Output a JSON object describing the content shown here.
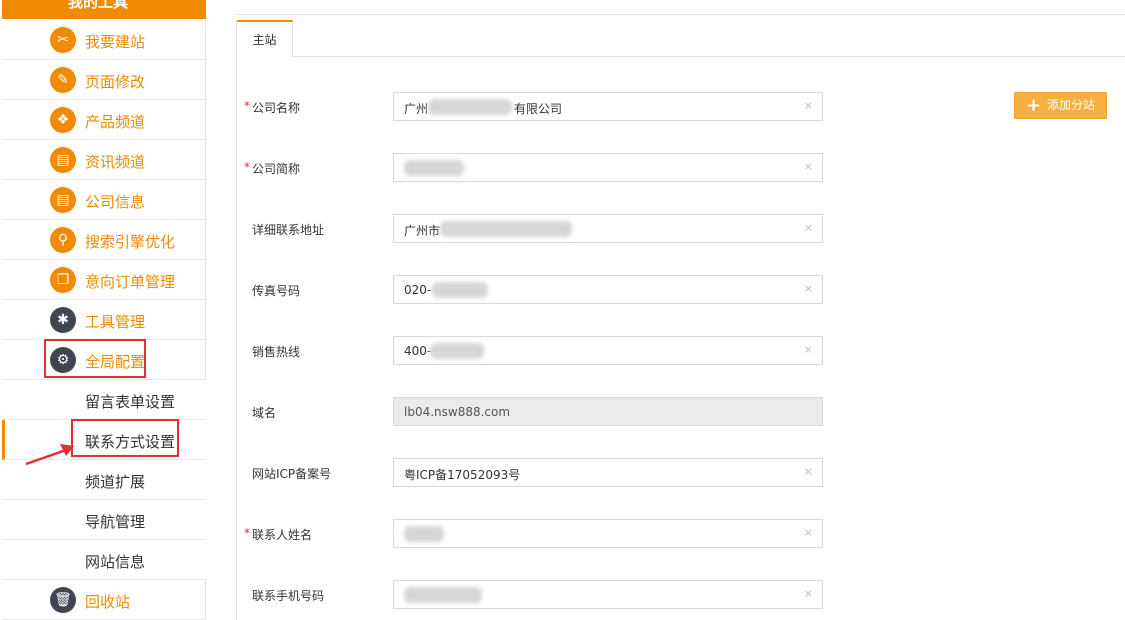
{
  "sidebar": {
    "top_label": "我的工具",
    "items": [
      {
        "label": "我要建站",
        "icon": "tools-icon"
      },
      {
        "label": "页面修改",
        "icon": "pencil-icon"
      },
      {
        "label": "产品频道",
        "icon": "box-icon"
      },
      {
        "label": "资讯频道",
        "icon": "news-icon"
      },
      {
        "label": "公司信息",
        "icon": "document-icon"
      },
      {
        "label": "搜索引擎优化",
        "icon": "search-icon"
      },
      {
        "label": "意向订单管理",
        "icon": "copy-icon"
      },
      {
        "label": "工具管理",
        "icon": "wrench-icon"
      },
      {
        "label": "全局配置",
        "icon": "gear-icon"
      }
    ],
    "sub_items": [
      "留言表单设置",
      "联系方式设置",
      "频道扩展",
      "导航管理",
      "网站信息"
    ],
    "bottom_item": {
      "label": "回收站",
      "icon": "trash-icon"
    }
  },
  "tabs": [
    "主站"
  ],
  "add_branch_button": "添加分站",
  "form": {
    "fields": [
      {
        "label": "公司名称",
        "required": true,
        "value_prefix": "广州",
        "value_suffix": "有限公司",
        "disabled": false
      },
      {
        "label": "公司简称",
        "required": true,
        "value_prefix": "",
        "value_suffix": "",
        "disabled": false
      },
      {
        "label": "详细联系地址",
        "required": false,
        "value_prefix": "广州市",
        "value_suffix": "",
        "disabled": false
      },
      {
        "label": "传真号码",
        "required": false,
        "value_prefix": "020-",
        "value_suffix": "",
        "disabled": false
      },
      {
        "label": "销售热线",
        "required": false,
        "value_prefix": "400-",
        "value_suffix": "",
        "disabled": false
      },
      {
        "label": "域名",
        "required": false,
        "value_prefix": "lb04.nsw888.com",
        "value_suffix": "",
        "disabled": true
      },
      {
        "label": "网站ICP备案号",
        "required": false,
        "value_prefix": "粤ICP备17052093号",
        "value_suffix": "",
        "disabled": false
      },
      {
        "label": "联系人姓名",
        "required": true,
        "value_prefix": "",
        "value_suffix": "",
        "disabled": false
      },
      {
        "label": "联系手机号码",
        "required": false,
        "value_prefix": "",
        "value_suffix": "",
        "disabled": false
      }
    ],
    "required_mark": "*",
    "clear_glyph": "×"
  },
  "colors": {
    "accent": "#f08a00",
    "highlight_box": "#e03030",
    "dark_icon": "#3f4652"
  }
}
